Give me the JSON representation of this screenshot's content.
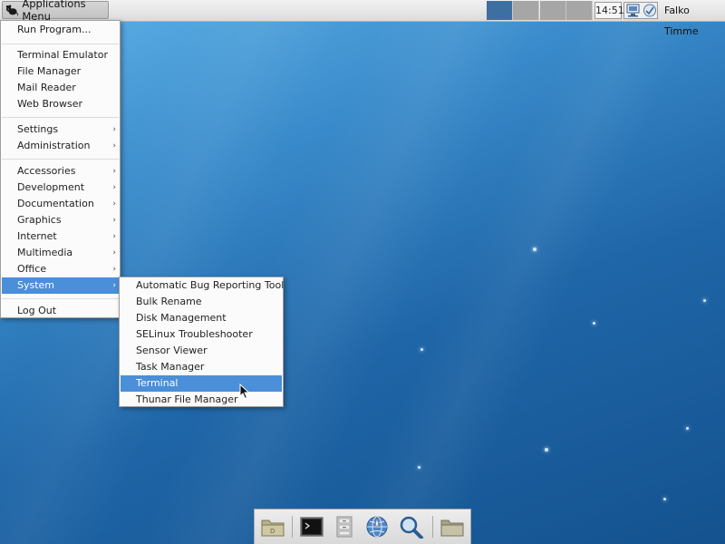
{
  "top_panel": {
    "apps_menu_label": "Applications Menu",
    "clock": "14:51",
    "username": "Falko Timme",
    "workspaces": 4,
    "active_workspace": 1
  },
  "app_menu": {
    "run_program": "Run Program...",
    "terminal_emulator": "Terminal Emulator",
    "file_manager": "File Manager",
    "mail_reader": "Mail Reader",
    "web_browser": "Web Browser",
    "settings": "Settings",
    "administration": "Administration",
    "accessories": "Accessories",
    "development": "Development",
    "documentation": "Documentation",
    "graphics": "Graphics",
    "internet": "Internet",
    "multimedia": "Multimedia",
    "office": "Office",
    "system": "System",
    "log_out": "Log Out",
    "submenu_arrow": "›"
  },
  "system_submenu": {
    "items": [
      "Automatic Bug Reporting Tool",
      "Bulk Rename",
      "Disk Management",
      "SELinux Troubleshooter",
      "Sensor Viewer",
      "Task Manager",
      "Terminal",
      "Thunar File Manager"
    ],
    "selected": "Terminal"
  },
  "dock": {
    "icons": [
      "desktop-folder-icon",
      "terminal-icon",
      "file-cabinet-icon",
      "web-browser-icon",
      "search-icon",
      "folder-icon"
    ]
  },
  "colors": {
    "selection": "#4a8fd8",
    "active_workspace": "#3d6fa3"
  }
}
